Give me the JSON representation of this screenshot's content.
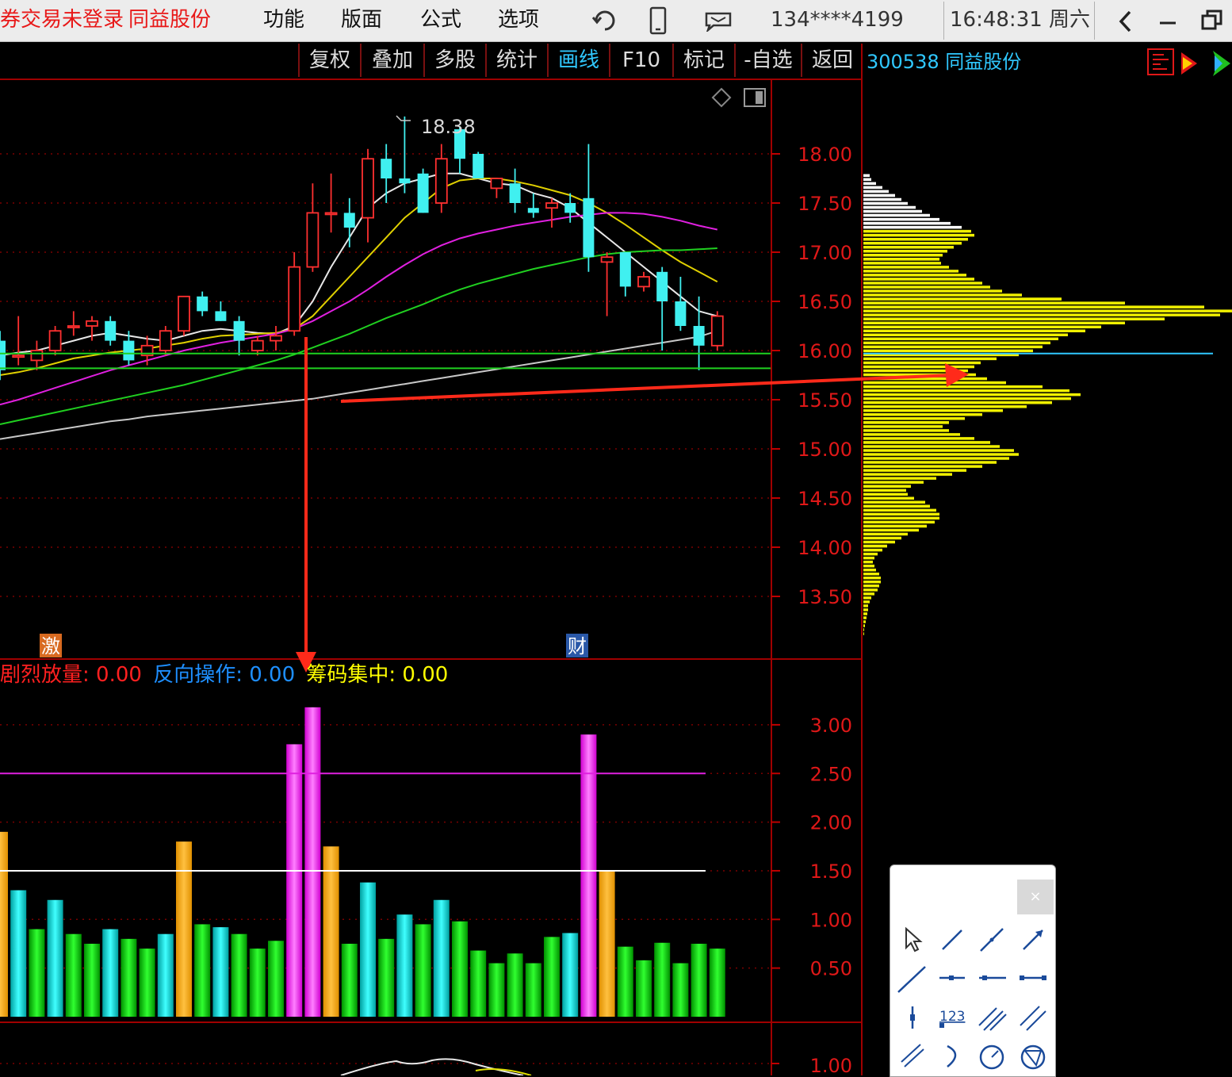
{
  "app": {
    "login_status": "券交易未登录",
    "stock_name_top": "同益股份",
    "menu": [
      "功能",
      "版面",
      "公式",
      "选项"
    ],
    "account": "134****4199",
    "time": "16:48:31 周六"
  },
  "toolbar": {
    "buttons": [
      "复权",
      "叠加",
      "多股",
      "统计",
      "画线",
      "F10",
      "标记",
      "-自选",
      "返回"
    ],
    "active": "画线",
    "stock_code_label": "300538 同益股份"
  },
  "price_chart": {
    "high_label": "18.38",
    "y_axis_ticks": [
      "18.00",
      "17.50",
      "17.00",
      "16.50",
      "16.00",
      "15.50",
      "15.00",
      "14.50",
      "14.00",
      "13.50"
    ],
    "markers": [
      {
        "text": "激"
      },
      {
        "text": "财"
      }
    ]
  },
  "indicator": {
    "legend": [
      {
        "label": "剧烈放量:",
        "value": "0.00",
        "color": "#ff2020"
      },
      {
        "label": "反向操作:",
        "value": "0.00",
        "color": "#1e8fff"
      },
      {
        "label": "筹码集中:",
        "value": "0.00",
        "color": "#ffff00"
      }
    ],
    "y_axis_ticks": [
      "3.00",
      "2.50",
      "2.00",
      "1.50",
      "1.00",
      "0.50"
    ]
  },
  "sub_chart": {
    "y_axis_ticks": [
      "1.00"
    ]
  },
  "draw_panel": {
    "close": "×",
    "label_123": "123"
  },
  "chart_data": {
    "type": "candlestick",
    "candles": [
      {
        "o": 16.1,
        "h": 16.2,
        "l": 15.7,
        "c": 15.8
      },
      {
        "o": 15.95,
        "h": 16.35,
        "l": 15.85,
        "c": 15.95
      },
      {
        "o": 15.9,
        "h": 16.1,
        "l": 15.8,
        "c": 16.0
      },
      {
        "o": 16.0,
        "h": 16.25,
        "l": 15.95,
        "c": 16.2
      },
      {
        "o": 16.25,
        "h": 16.4,
        "l": 16.15,
        "c": 16.25
      },
      {
        "o": 16.25,
        "h": 16.35,
        "l": 16.1,
        "c": 16.3
      },
      {
        "o": 16.3,
        "h": 16.35,
        "l": 16.05,
        "c": 16.1
      },
      {
        "o": 16.1,
        "h": 16.2,
        "l": 15.85,
        "c": 15.9
      },
      {
        "o": 15.95,
        "h": 16.15,
        "l": 15.85,
        "c": 16.05
      },
      {
        "o": 16.0,
        "h": 16.25,
        "l": 15.95,
        "c": 16.2
      },
      {
        "o": 16.2,
        "h": 16.55,
        "l": 16.15,
        "c": 16.55
      },
      {
        "o": 16.55,
        "h": 16.6,
        "l": 16.35,
        "c": 16.4
      },
      {
        "o": 16.4,
        "h": 16.5,
        "l": 16.3,
        "c": 16.3
      },
      {
        "o": 16.3,
        "h": 16.35,
        "l": 15.95,
        "c": 16.1
      },
      {
        "o": 16.0,
        "h": 16.15,
        "l": 15.95,
        "c": 16.1
      },
      {
        "o": 16.1,
        "h": 16.25,
        "l": 16.0,
        "c": 16.15
      },
      {
        "o": 16.2,
        "h": 17.0,
        "l": 16.15,
        "c": 16.85
      },
      {
        "o": 16.85,
        "h": 17.7,
        "l": 16.8,
        "c": 17.4
      },
      {
        "o": 17.4,
        "h": 17.8,
        "l": 17.2,
        "c": 17.4
      },
      {
        "o": 17.4,
        "h": 17.55,
        "l": 17.05,
        "c": 17.25
      },
      {
        "o": 17.35,
        "h": 18.05,
        "l": 17.1,
        "c": 17.95
      },
      {
        "o": 17.95,
        "h": 18.1,
        "l": 17.5,
        "c": 17.75
      },
      {
        "o": 17.75,
        "h": 18.38,
        "l": 17.6,
        "c": 17.7
      },
      {
        "o": 17.8,
        "h": 17.85,
        "l": 17.4,
        "c": 17.4
      },
      {
        "o": 17.5,
        "h": 18.1,
        "l": 17.4,
        "c": 17.95
      },
      {
        "o": 18.25,
        "h": 18.28,
        "l": 17.8,
        "c": 17.95
      },
      {
        "o": 18.0,
        "h": 18.02,
        "l": 17.75,
        "c": 17.75
      },
      {
        "o": 17.65,
        "h": 17.75,
        "l": 17.55,
        "c": 17.75
      },
      {
        "o": 17.7,
        "h": 17.85,
        "l": 17.4,
        "c": 17.5
      },
      {
        "o": 17.45,
        "h": 17.6,
        "l": 17.35,
        "c": 17.4
      },
      {
        "o": 17.45,
        "h": 17.55,
        "l": 17.25,
        "c": 17.5
      },
      {
        "o": 17.5,
        "h": 17.6,
        "l": 17.3,
        "c": 17.4
      },
      {
        "o": 17.55,
        "h": 18.1,
        "l": 16.8,
        "c": 16.95
      },
      {
        "o": 16.9,
        "h": 17.0,
        "l": 16.35,
        "c": 16.95
      },
      {
        "o": 17.0,
        "h": 17.0,
        "l": 16.55,
        "c": 16.65
      },
      {
        "o": 16.65,
        "h": 16.8,
        "l": 16.6,
        "c": 16.75
      },
      {
        "o": 16.8,
        "h": 16.85,
        "l": 16.0,
        "c": 16.5
      },
      {
        "o": 16.5,
        "h": 16.75,
        "l": 16.2,
        "c": 16.25
      },
      {
        "o": 16.25,
        "h": 16.55,
        "l": 15.8,
        "c": 16.05
      },
      {
        "o": 16.05,
        "h": 16.4,
        "l": 16.0,
        "c": 16.35
      }
    ],
    "price_range": [
      13.1,
      18.6
    ],
    "reference_lines": [
      15.97,
      15.82
    ],
    "ma_lines": {
      "white": [
        15.95,
        15.98,
        16.0,
        16.05,
        16.1,
        16.15,
        16.18,
        16.15,
        16.12,
        16.1,
        16.15,
        16.2,
        16.22,
        16.2,
        16.18,
        16.17,
        16.25,
        16.5,
        16.85,
        17.15,
        17.45,
        17.6,
        17.7,
        17.75,
        17.8,
        17.8,
        17.75,
        17.7,
        17.68,
        17.6,
        17.55,
        17.45,
        17.3,
        17.15,
        17.0,
        16.85,
        16.7,
        16.55,
        16.4,
        16.35
      ],
      "yellow": [
        15.75,
        15.78,
        15.82,
        15.87,
        15.92,
        15.95,
        15.98,
        16.0,
        16.02,
        16.05,
        16.08,
        16.12,
        16.15,
        16.16,
        16.17,
        16.18,
        16.22,
        16.35,
        16.55,
        16.75,
        16.95,
        17.15,
        17.35,
        17.5,
        17.65,
        17.73,
        17.75,
        17.75,
        17.72,
        17.68,
        17.63,
        17.58,
        17.5,
        17.4,
        17.28,
        17.15,
        17.02,
        16.9,
        16.8,
        16.7
      ],
      "magenta": [
        15.45,
        15.5,
        15.56,
        15.62,
        15.68,
        15.74,
        15.8,
        15.85,
        15.9,
        15.95,
        16.0,
        16.04,
        16.08,
        16.11,
        16.14,
        16.17,
        16.22,
        16.3,
        16.4,
        16.5,
        16.62,
        16.75,
        16.87,
        16.98,
        17.07,
        17.14,
        17.19,
        17.23,
        17.27,
        17.3,
        17.33,
        17.36,
        17.38,
        17.4,
        17.4,
        17.39,
        17.36,
        17.32,
        17.27,
        17.23
      ],
      "green": [
        15.25,
        15.29,
        15.33,
        15.37,
        15.41,
        15.45,
        15.49,
        15.53,
        15.57,
        15.61,
        15.65,
        15.7,
        15.75,
        15.8,
        15.85,
        15.9,
        15.96,
        16.03,
        16.1,
        16.17,
        16.25,
        16.33,
        16.4,
        16.47,
        16.55,
        16.62,
        16.68,
        16.73,
        16.78,
        16.83,
        16.87,
        16.91,
        16.95,
        16.98,
        17.0,
        17.01,
        17.02,
        17.02,
        17.03,
        17.04
      ],
      "gray": [
        15.1,
        15.13,
        15.16,
        15.19,
        15.22,
        15.25,
        15.28,
        15.3,
        15.33,
        15.35,
        15.37,
        15.39,
        15.41,
        15.43,
        15.45,
        15.47,
        15.49,
        15.51,
        15.54,
        15.57,
        15.6,
        15.63,
        15.66,
        15.69,
        15.72,
        15.75,
        15.78,
        15.81,
        15.84,
        15.87,
        15.9,
        15.93,
        15.96,
        15.99,
        16.02,
        16.05,
        16.08,
        16.11,
        16.14,
        16.2
      ]
    },
    "volume_profile": {
      "y_min": 13.1,
      "y_max": 17.8,
      "widths": [
        1,
        1,
        2,
        3,
        4,
        5,
        6,
        6,
        8,
        10,
        14,
        18,
        20,
        22,
        22,
        20,
        16,
        14,
        12,
        14,
        18,
        24,
        30,
        40,
        48,
        56,
        70,
        80,
        90,
        96,
        96,
        92,
        84,
        78,
        64,
        56,
        54,
        60,
        76,
        92,
        112,
        130,
        150,
        168,
        184,
        196,
        190,
        172,
        160,
        140,
        122,
        108,
        100,
        108,
        128,
        150,
        176,
        206,
        238,
        262,
        274,
        260,
        226,
        180,
        156,
        142,
        132,
        140,
        148,
        168,
        196,
        214,
        226,
        236,
        246,
        258,
        280,
        300,
        330,
        380,
        450,
        520,
        430,
        330,
        250,
        200,
        175,
        160,
        150,
        140,
        130,
        120,
        108,
        98,
        96,
        100,
        106,
        114,
        124,
        132,
        140,
        136,
        124,
        110,
        96,
        84,
        74,
        66,
        56,
        48,
        40,
        32,
        24,
        16,
        10,
        8
      ]
    },
    "indicator_range": [
      0,
      3.3
    ],
    "indicator_lines": [
      {
        "value": 2.5,
        "color": "#e020e0"
      },
      {
        "value": 1.5,
        "color": "#ffffff"
      }
    ],
    "indicator_bars": [
      {
        "v": 1.9,
        "c": "orange"
      },
      {
        "v": 1.3,
        "c": "cyan"
      },
      {
        "v": 0.9,
        "c": "green"
      },
      {
        "v": 1.2,
        "c": "cyan"
      },
      {
        "v": 0.85,
        "c": "green"
      },
      {
        "v": 0.75,
        "c": "green"
      },
      {
        "v": 0.9,
        "c": "cyan"
      },
      {
        "v": 0.8,
        "c": "green"
      },
      {
        "v": 0.7,
        "c": "green"
      },
      {
        "v": 0.85,
        "c": "cyan"
      },
      {
        "v": 1.8,
        "c": "orange"
      },
      {
        "v": 0.95,
        "c": "green"
      },
      {
        "v": 0.92,
        "c": "cyan"
      },
      {
        "v": 0.85,
        "c": "green"
      },
      {
        "v": 0.7,
        "c": "green"
      },
      {
        "v": 0.78,
        "c": "green"
      },
      {
        "v": 2.8,
        "c": "magenta"
      },
      {
        "v": 3.18,
        "c": "magenta"
      },
      {
        "v": 1.75,
        "c": "orange"
      },
      {
        "v": 0.75,
        "c": "green"
      },
      {
        "v": 1.38,
        "c": "cyan"
      },
      {
        "v": 0.8,
        "c": "green"
      },
      {
        "v": 1.05,
        "c": "cyan"
      },
      {
        "v": 0.95,
        "c": "green"
      },
      {
        "v": 1.2,
        "c": "cyan"
      },
      {
        "v": 0.98,
        "c": "green"
      },
      {
        "v": 0.68,
        "c": "green"
      },
      {
        "v": 0.55,
        "c": "green"
      },
      {
        "v": 0.65,
        "c": "green"
      },
      {
        "v": 0.55,
        "c": "green"
      },
      {
        "v": 0.82,
        "c": "green"
      },
      {
        "v": 0.86,
        "c": "cyan"
      },
      {
        "v": 2.9,
        "c": "magenta"
      },
      {
        "v": 1.5,
        "c": "orange"
      },
      {
        "v": 0.72,
        "c": "green"
      },
      {
        "v": 0.58,
        "c": "green"
      },
      {
        "v": 0.76,
        "c": "green"
      },
      {
        "v": 0.55,
        "c": "green"
      },
      {
        "v": 0.75,
        "c": "green"
      },
      {
        "v": 0.7,
        "c": "green"
      }
    ]
  }
}
